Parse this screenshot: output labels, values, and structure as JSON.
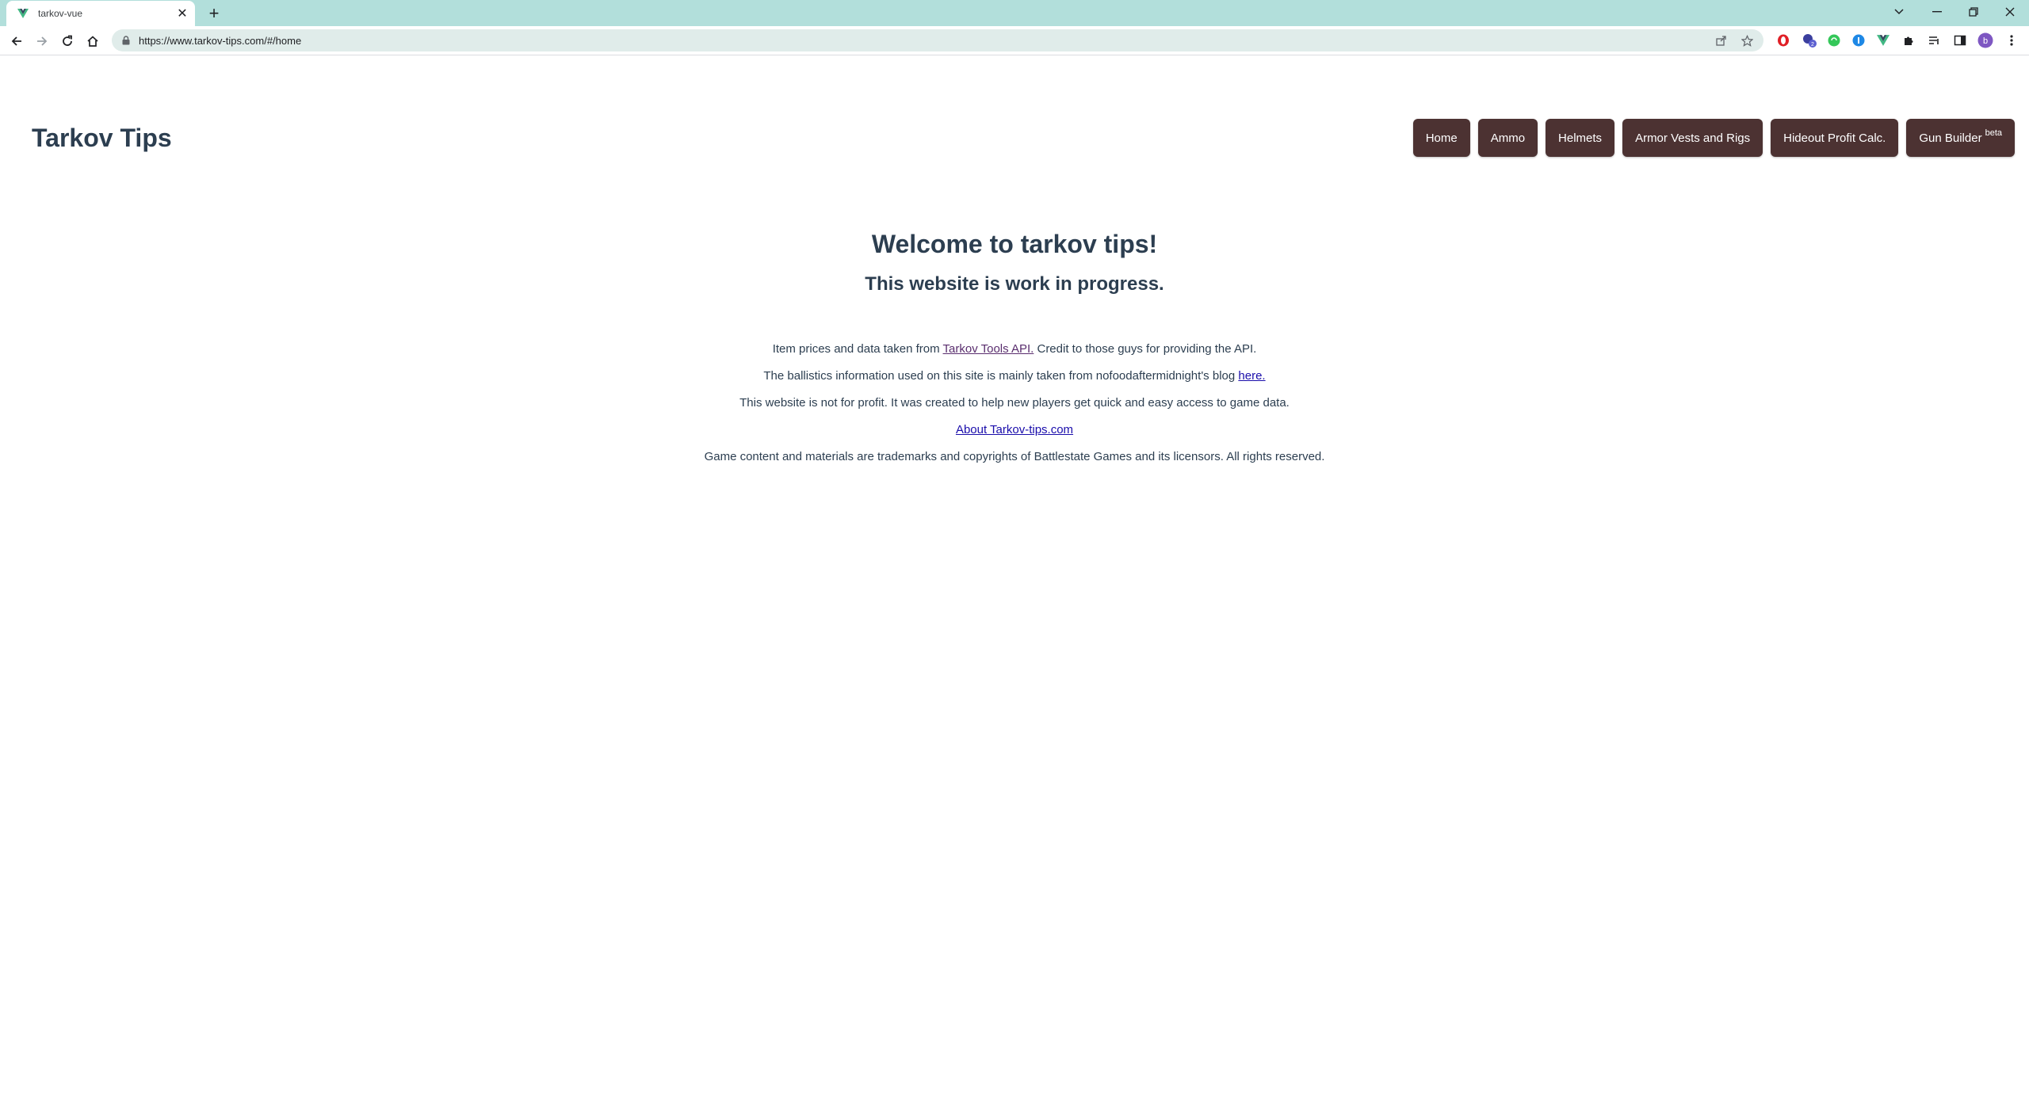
{
  "browser": {
    "tab_title": "tarkov-vue",
    "url": "https://www.tarkov-tips.com/#/home",
    "accent": "#b2dfdb"
  },
  "site": {
    "title": "Tarkov Tips",
    "nav": [
      {
        "label": "Home"
      },
      {
        "label": "Ammo"
      },
      {
        "label": "Helmets"
      },
      {
        "label": "Armor Vests and Rigs"
      },
      {
        "label": "Hideout Profit Calc."
      },
      {
        "label": "Gun Builder",
        "badge": "beta"
      }
    ],
    "nav_color": "#4c3232"
  },
  "main": {
    "welcome": "Welcome to tarkov tips!",
    "subtitle": "This website is work in progress.",
    "line1_pre": "Item prices and data taken from ",
    "line1_link": "Tarkov Tools API.",
    "line1_post": " Credit to those guys for providing the API.",
    "line2_pre": "The ballistics information used on this site is mainly taken from nofoodaftermidnight's blog ",
    "line2_link": "here.",
    "line3": "This website is not for profit. It was created to help new players get quick and easy access to game data.",
    "line4_link": "About Tarkov-tips.com",
    "line5": "Game content and materials are trademarks and copyrights of Battlestate Games and its licensors. All rights reserved."
  }
}
